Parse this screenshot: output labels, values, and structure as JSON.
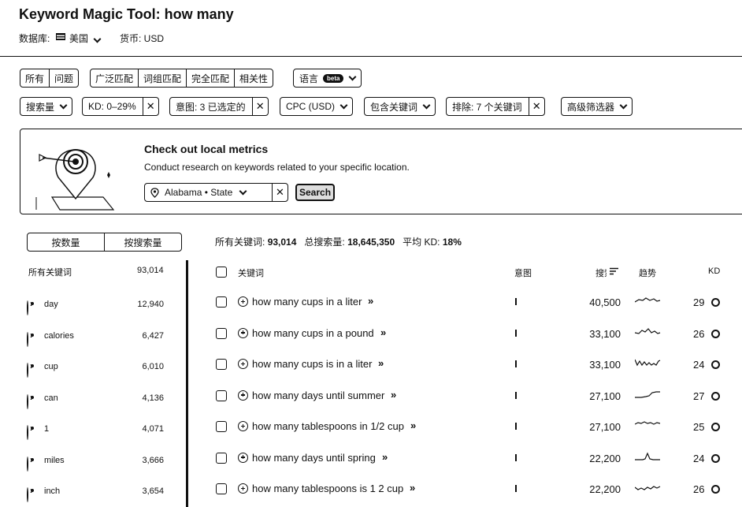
{
  "header": {
    "title": "Keyword Magic Tool:  how many",
    "database_label": "数据库:",
    "database_value": "美国",
    "currency_label": "货币: USD"
  },
  "match_tabs": [
    "所有",
    "问题"
  ],
  "match_types": [
    "广泛匹配",
    "词组匹配",
    "完全匹配",
    "相关性"
  ],
  "language": {
    "label": "语言",
    "badge": "beta"
  },
  "filters": {
    "volume": "搜索量",
    "kd": "KD: 0–29%",
    "intent": "意图: 3 已选定的",
    "cpc": "CPC (USD)",
    "include": "包含关键词",
    "exclude": "排除: 7 个关键词",
    "advanced": "高级筛选器"
  },
  "local_card": {
    "title": "Check out local metrics",
    "subtitle": "Conduct research on keywords related to your specific location.",
    "location": "Alabama • State",
    "search_label": "Search"
  },
  "group_toggle": [
    "按数量",
    "按搜索量"
  ],
  "summary": {
    "all_keywords_label": "所有关键词:",
    "all_keywords_value": "93,014",
    "total_volume_label": "总搜索量:",
    "total_volume_value": "18,645,350",
    "avg_kd_label": "平均 KD:",
    "avg_kd_value": "18%"
  },
  "groups": {
    "header_label": "所有关键词",
    "header_count": "93,014",
    "items": [
      {
        "label": "day",
        "count": "12,940"
      },
      {
        "label": "calories",
        "count": "6,427"
      },
      {
        "label": "cup",
        "count": "6,010"
      },
      {
        "label": "can",
        "count": "4,136"
      },
      {
        "label": "1",
        "count": "4,071"
      },
      {
        "label": "miles",
        "count": "3,666"
      },
      {
        "label": "inch",
        "count": "3,654"
      }
    ]
  },
  "table": {
    "columns": [
      "关键词",
      "意图",
      "搜索",
      "趋势",
      "KD"
    ],
    "rows": [
      {
        "keyword": "how many cups in a liter",
        "volume": "40,500",
        "kd": "29",
        "trend": "wave"
      },
      {
        "keyword": "how many cups in a pound",
        "volume": "33,100",
        "kd": "26",
        "trend": "wave2"
      },
      {
        "keyword": "how many cups is in a liter",
        "volume": "33,100",
        "kd": "24",
        "trend": "spiky"
      },
      {
        "keyword": "how many days until summer",
        "volume": "27,100",
        "kd": "27",
        "trend": "rise"
      },
      {
        "keyword": "how many tablespoons in 1/2 cup",
        "volume": "27,100",
        "kd": "25",
        "trend": "flatwave"
      },
      {
        "keyword": "how many days until spring",
        "volume": "22,200",
        "kd": "24",
        "trend": "peak"
      },
      {
        "keyword": "how many tablespoons is 1 2 cup",
        "volume": "22,200",
        "kd": "26",
        "trend": "wave3"
      }
    ]
  }
}
